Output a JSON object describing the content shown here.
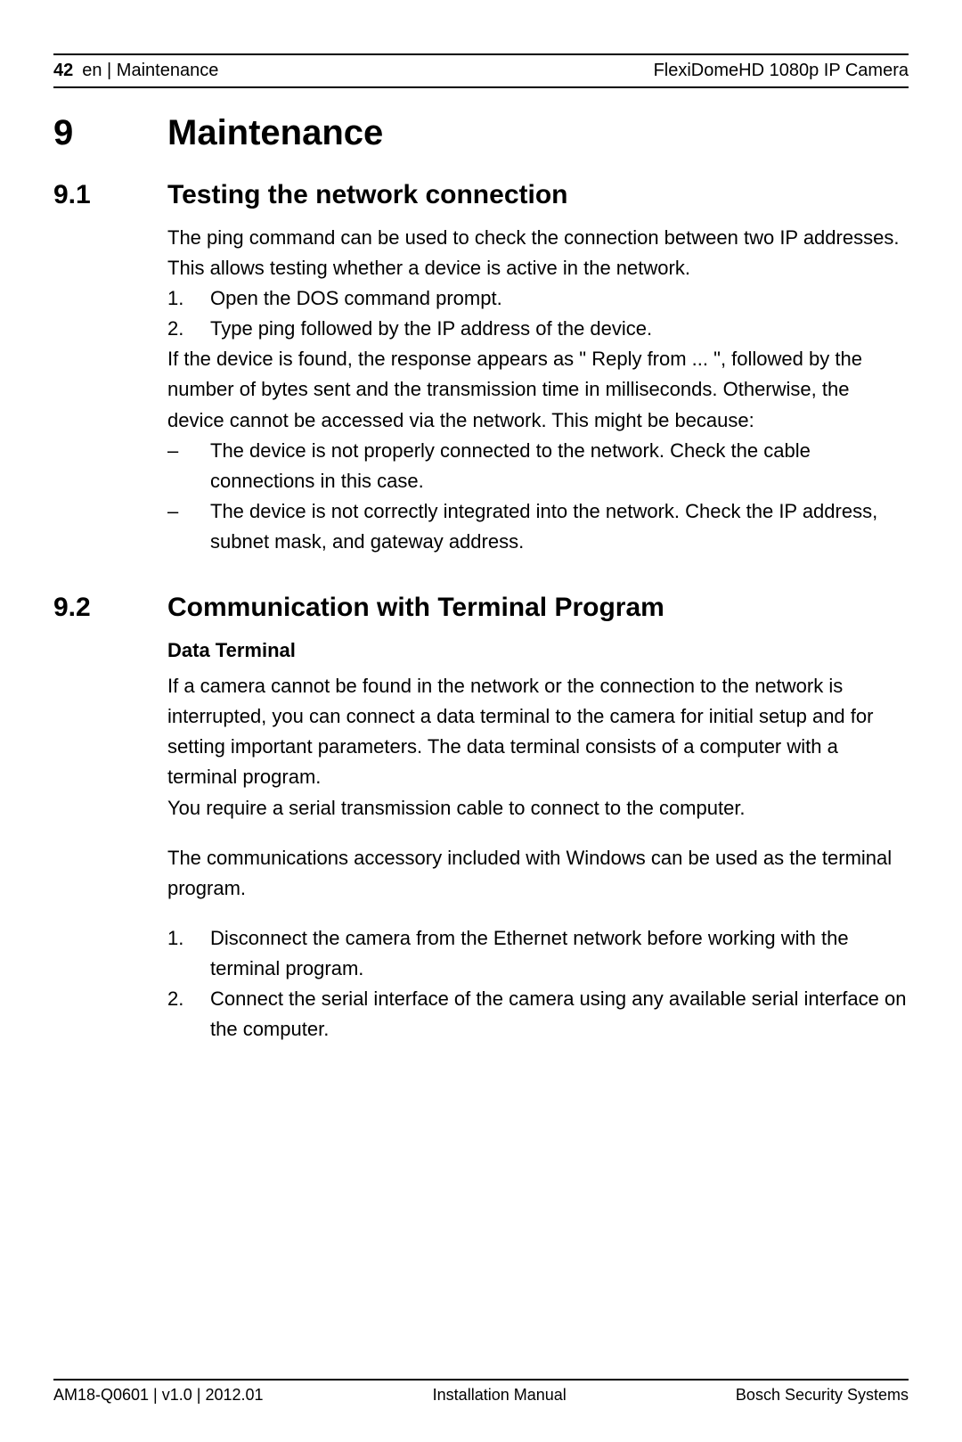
{
  "header": {
    "page_number": "42",
    "breadcrumb": "en | Maintenance",
    "product": "FlexiDomeHD 1080p IP Camera"
  },
  "chapter": {
    "number": "9",
    "title": "Maintenance"
  },
  "section1": {
    "number": "9.1",
    "title": "Testing the network connection",
    "intro": "The ping command can be used to check the connection between two IP addresses. This allows testing whether a device is active in the network.",
    "step1_marker": "1.",
    "step1_text": "Open the DOS command prompt.",
    "step2_marker": "2.",
    "step2_text": "Type ping followed by the IP address of the device.",
    "result": "If the device is found, the response appears as \" Reply from ... \", followed by the number of bytes sent and the transmission time in milliseconds. Otherwise, the device cannot be accessed via the network. This might be because:",
    "bullet_marker": "–",
    "bullet1": "The device is not properly connected to the network. Check the cable connections in this case.",
    "bullet2": "The device is not correctly integrated into the network. Check the IP address, subnet mask, and gateway address."
  },
  "section2": {
    "number": "9.2",
    "title": "Communication with Terminal Program",
    "subheading": "Data Terminal",
    "p1": "If a camera cannot be found in the network or the connection to the network is interrupted, you can connect a data terminal to the camera for initial setup and for setting important parameters. The data terminal consists of a computer with a terminal program.",
    "p2": "You require a serial transmission cable to connect to the computer.",
    "p3": "The communications accessory included with Windows can be used as the terminal program.",
    "step1_marker": "1.",
    "step1_text": "Disconnect the camera from the Ethernet network before working with the terminal program.",
    "step2_marker": "2.",
    "step2_text": "Connect the serial interface of the camera using any available serial interface on the computer."
  },
  "footer": {
    "left": "AM18-Q0601 | v1.0 | 2012.01",
    "center": "Installation Manual",
    "right": "Bosch Security Systems"
  }
}
